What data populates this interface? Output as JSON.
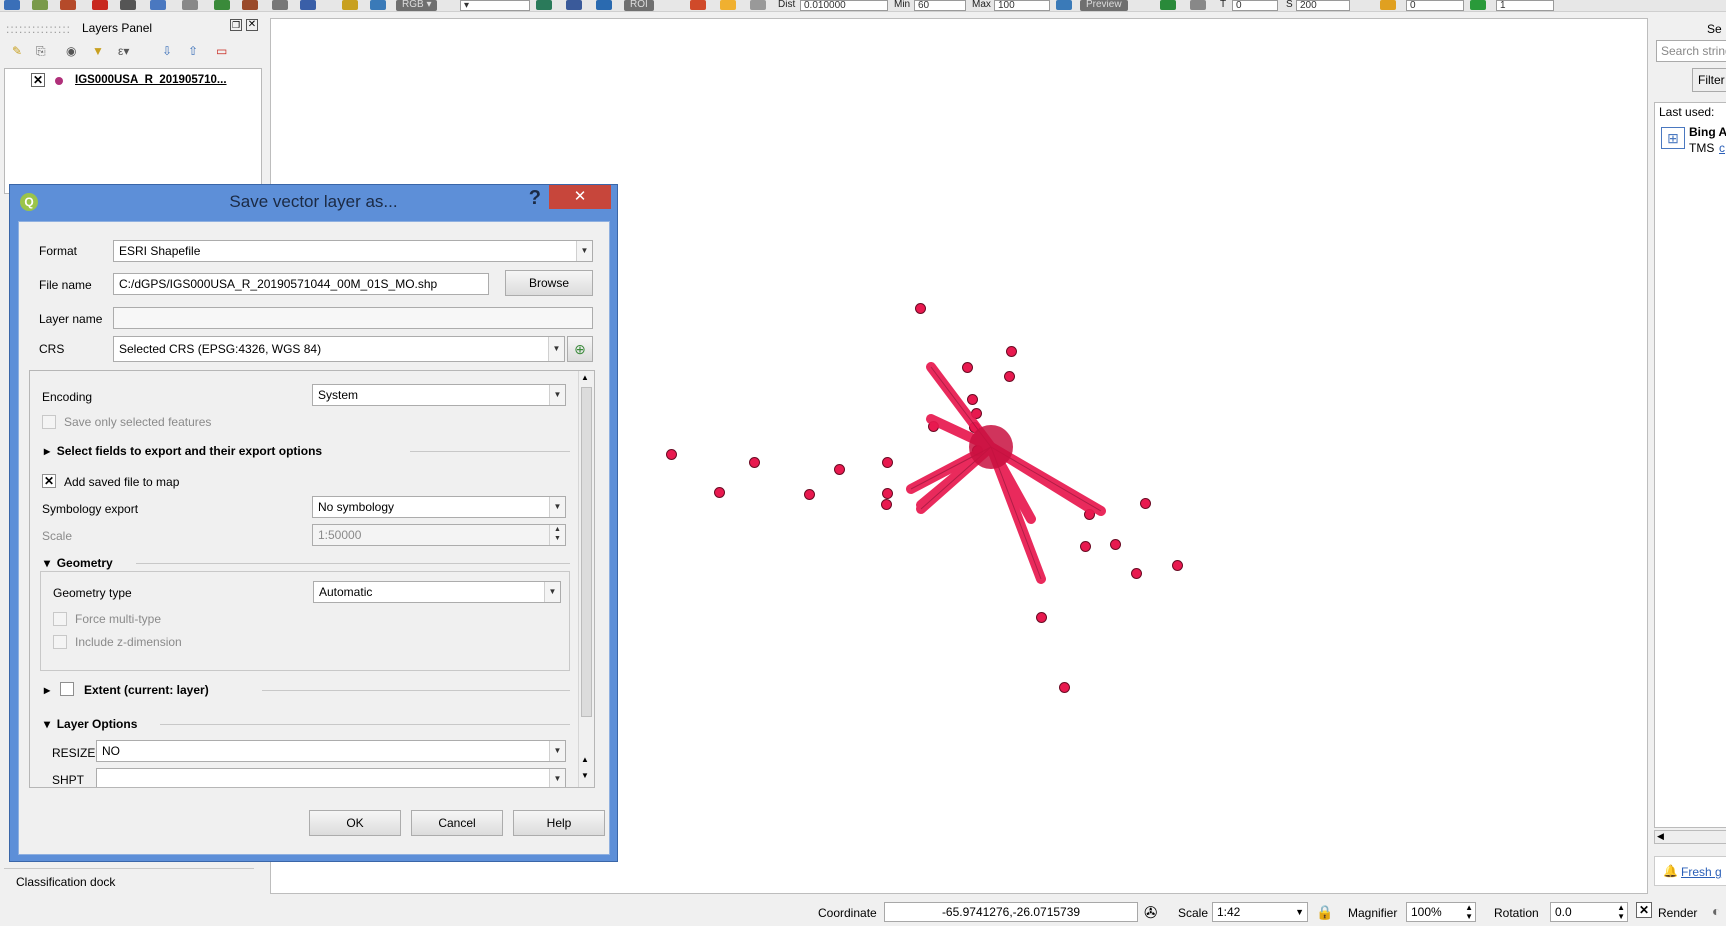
{
  "toolbar": {
    "rgb_label": "RGB",
    "roi_label": "ROI",
    "dist_label": "Dist",
    "dist_value": "0.010000",
    "min_label": "Min",
    "min_value": "60",
    "max_label": "Max",
    "max_value": "100",
    "preview_label": "Preview",
    "t_label": "T",
    "t_value": "0",
    "s_label": "S",
    "s_value": "200",
    "field1_value": "0",
    "field2_value": "1"
  },
  "layers_panel": {
    "title": "Layers Panel",
    "layer_name": "IGS000USA_R_201905710...",
    "bottom_tab": "Classification dock"
  },
  "right_panel": {
    "search_placeholder": "Search string",
    "filter_label": "Filter",
    "last_used_label": "Last used:",
    "item_title": "Bing A",
    "item_sub": "TMS",
    "item_link": "c",
    "fresh_link": "Fresh g",
    "header": "Se"
  },
  "dialog": {
    "title": "Save vector layer as...",
    "help_symbol": "?",
    "format_label": "Format",
    "format_value": "ESRI Shapefile",
    "filename_label": "File name",
    "filename_value": "C:/dGPS/IGS000USA_R_20190571044_00M_01S_MO.shp",
    "browse_label": "Browse",
    "layername_label": "Layer name",
    "layername_value": "",
    "crs_label": "CRS",
    "crs_value": "Selected CRS (EPSG:4326, WGS 84)",
    "encoding_label": "Encoding",
    "encoding_value": "System",
    "save_selected_label": "Save only selected features",
    "select_fields_label": "Select fields to export and their export options",
    "add_saved_label": "Add saved file to map",
    "symbology_label": "Symbology export",
    "symbology_value": "No symbology",
    "scale_label": "Scale",
    "scale_value": "1:50000",
    "geometry_section": "Geometry",
    "geometry_type_label": "Geometry type",
    "geometry_type_value": "Automatic",
    "force_multi_label": "Force multi-type",
    "include_z_label": "Include z-dimension",
    "extent_label": "Extent (current: layer)",
    "layer_options_section": "Layer Options",
    "resize_label": "RESIZE",
    "resize_value": "NO",
    "shpt_label": "SHPT",
    "shpt_value": "",
    "ok_label": "OK",
    "cancel_label": "Cancel",
    "help_label": "Help"
  },
  "statusbar": {
    "coordinate_label": "Coordinate",
    "coordinate_value": "-65.9741276,-26.0715739",
    "scale_label": "Scale",
    "scale_value": "1:42",
    "magnifier_label": "Magnifier",
    "magnifier_value": "100%",
    "rotation_label": "Rotation",
    "rotation_value": "0.0",
    "render_label": "Render"
  },
  "colors": {
    "point_fill": "#e8194f",
    "dialog_frame": "#5d8fd8",
    "close_button": "#c7463b"
  }
}
